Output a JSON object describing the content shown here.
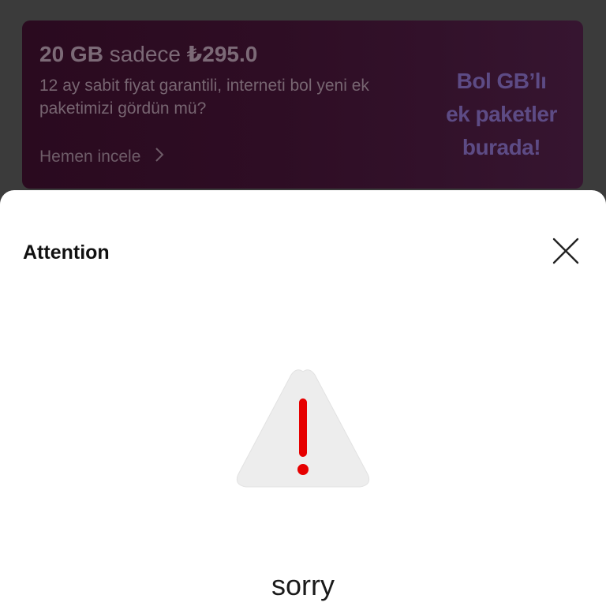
{
  "promo": {
    "title_gb": "20 GB",
    "title_sadece": "sadece",
    "title_price": "₺295.0",
    "description": "12 ay sabit fiyat garantili, interneti bol yeni ek paketimizi gördün mü?",
    "link_label": "Hemen incele",
    "badge_lines": [
      "Bol GB’lı",
      "ek paketler",
      "burada!"
    ]
  },
  "dialog": {
    "title": "Attention",
    "message": "sorry"
  },
  "icons": {
    "close": "close-icon",
    "warning": "warning-triangle-icon",
    "chevron": "chevron-right-icon"
  },
  "colors": {
    "accent": "#e60000",
    "overlay": "#3b3b3b",
    "sheet": "#ffffff"
  }
}
